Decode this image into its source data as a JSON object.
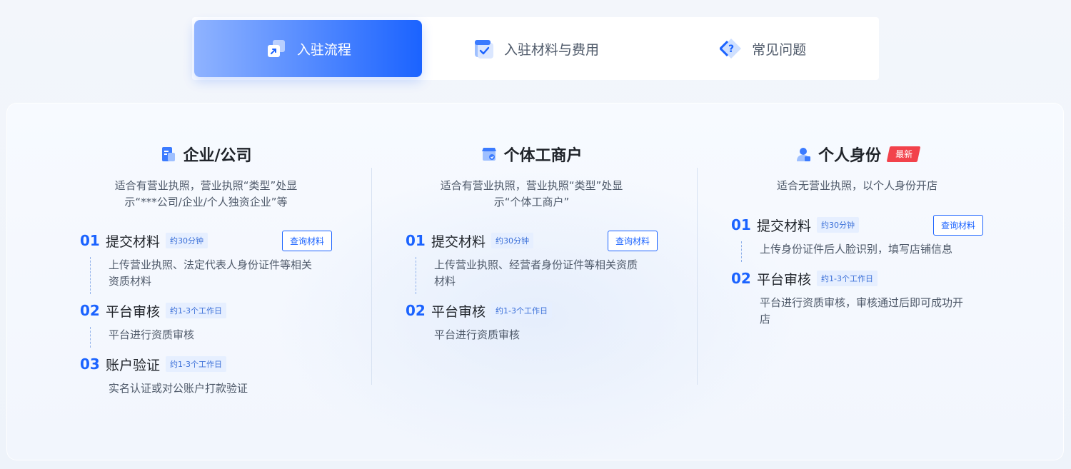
{
  "tabs": [
    {
      "label": "入驻流程",
      "icon": "flow-icon",
      "active": true
    },
    {
      "label": "入驻材料与费用",
      "icon": "document-check-icon",
      "active": false
    },
    {
      "label": "常见问题",
      "icon": "question-icon",
      "active": false
    }
  ],
  "columns": [
    {
      "title": "企业/公司",
      "icon": "company-icon",
      "desc_lines": [
        "适合有营业执照，营业执照“类型”处显",
        "示“***公司/企业/个人独资企业”等"
      ],
      "steps": [
        {
          "num": "01",
          "title": "提交材料",
          "tag": "约30分钟",
          "button": "查询材料",
          "body_lines": [
            "上传营业执照、法定代表人身份证件等相关",
            "资质材料"
          ]
        },
        {
          "num": "02",
          "title": "平台审核",
          "tag": "约1-3个工作日",
          "body_lines": [
            "平台进行资质审核"
          ]
        },
        {
          "num": "03",
          "title": "账户验证",
          "tag": "约1-3个工作日",
          "body_lines": [
            "实名认证或对公账户打款验证"
          ]
        }
      ]
    },
    {
      "title": "个体工商户",
      "icon": "shop-icon",
      "desc_lines": [
        "适合有营业执照，营业执照“类型”处显",
        "示“个体工商户”"
      ],
      "steps": [
        {
          "num": "01",
          "title": "提交材料",
          "tag": "约30分钟",
          "button": "查询材料",
          "body_lines": [
            "上传营业执照、经营者身份证件等相关资质",
            "材料"
          ]
        },
        {
          "num": "02",
          "title": "平台审核",
          "tag": "约1-3个工作日",
          "body_lines": [
            "平台进行资质审核"
          ]
        }
      ]
    },
    {
      "title": "个人身份",
      "icon": "person-icon",
      "badge": "最新",
      "desc_lines": [
        "适合无营业执照，以个人身份开店"
      ],
      "steps": [
        {
          "num": "01",
          "title": "提交材料",
          "tag": "约30分钟",
          "button": "查询材料",
          "body_lines": [
            "上传身份证件后人脸识别，填写店铺信息"
          ]
        },
        {
          "num": "02",
          "title": "平台审核",
          "tag": "约1-3个工作日",
          "body_lines": [
            "平台进行资质审核，审核通过后即可成功开",
            "店"
          ]
        }
      ]
    }
  ],
  "colors": {
    "accent": "#1b63ff",
    "badge": "#f2424b",
    "text": "#1f2329",
    "muted": "#4e5969"
  }
}
